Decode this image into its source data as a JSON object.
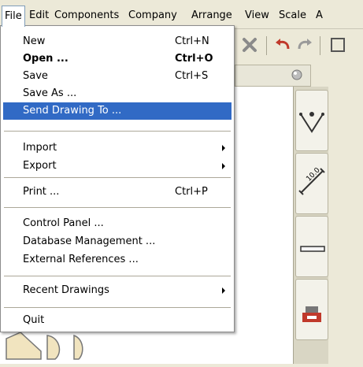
{
  "menubar": {
    "items": [
      "File",
      "Edit",
      "Components",
      "Company",
      "Arrange",
      "View",
      "Scale",
      "A"
    ]
  },
  "file_menu": {
    "new": {
      "label": "New",
      "shortcut": "Ctrl+N"
    },
    "open": {
      "label": "Open ...",
      "shortcut": "Ctrl+O"
    },
    "save": {
      "label": "Save",
      "shortcut": "Ctrl+S"
    },
    "save_as": {
      "label": "Save As ..."
    },
    "send_drawing_to": {
      "label": "Send Drawing To ..."
    },
    "import": {
      "label": "Import"
    },
    "export": {
      "label": "Export"
    },
    "print": {
      "label": "Print ...",
      "shortcut": "Ctrl+P"
    },
    "control_panel": {
      "label": "Control Panel ..."
    },
    "database_management": {
      "label": "Database Management ..."
    },
    "external_references": {
      "label": "External References ..."
    },
    "recent_drawings": {
      "label": "Recent Drawings"
    },
    "quit": {
      "label": "Quit"
    }
  },
  "palette": {
    "dimension_value": "10.0"
  },
  "colors": {
    "highlight": "#316ac5",
    "menu_bg": "#ffffff",
    "chrome": "#ece9d8"
  }
}
